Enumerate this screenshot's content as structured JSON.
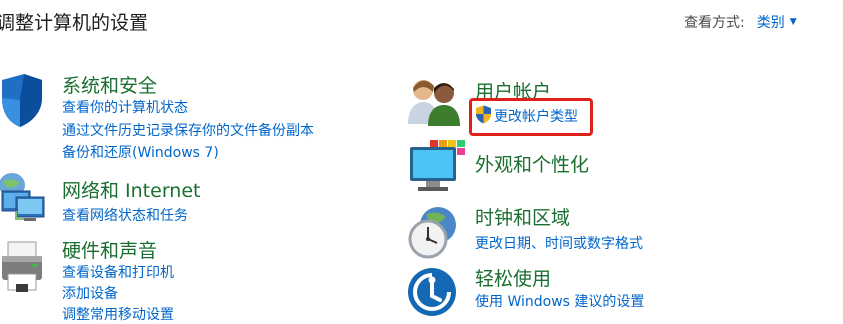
{
  "header": {
    "title": "调整计算机的设置",
    "view_by_label": "查看方式:",
    "view_by_value": "类别"
  },
  "categories": {
    "system_security": {
      "title": "系统和安全",
      "links": [
        "查看你的计算机状态",
        "通过文件历史记录保存你的文件备份副本",
        "备份和还原(Windows 7)"
      ]
    },
    "network": {
      "title": "网络和 Internet",
      "links": [
        "查看网络状态和任务"
      ]
    },
    "hardware": {
      "title": "硬件和声音",
      "links": [
        "查看设备和打印机",
        "添加设备",
        "调整常用移动设置"
      ]
    },
    "user_accounts": {
      "title": "用户帐户",
      "links": [
        "更改帐户类型"
      ]
    },
    "appearance": {
      "title": "外观和个性化"
    },
    "clock_region": {
      "title": "时钟和区域",
      "links": [
        "更改日期、时间或数字格式"
      ]
    },
    "ease_of_access": {
      "title": "轻松使用",
      "links": [
        "使用 Windows 建议的设置"
      ]
    }
  },
  "colors": {
    "category_title": "#1a6f30",
    "link": "#0066cc",
    "highlight": "#e0201b"
  },
  "icons": {
    "system_security": "shield-icon",
    "network": "network-computers-icon",
    "hardware": "printer-icon",
    "user_accounts": "users-icon",
    "uac": "uac-shield-icon",
    "appearance": "monitor-colors-icon",
    "clock_region": "clock-globe-icon",
    "ease_of_access": "ease-of-access-icon"
  }
}
